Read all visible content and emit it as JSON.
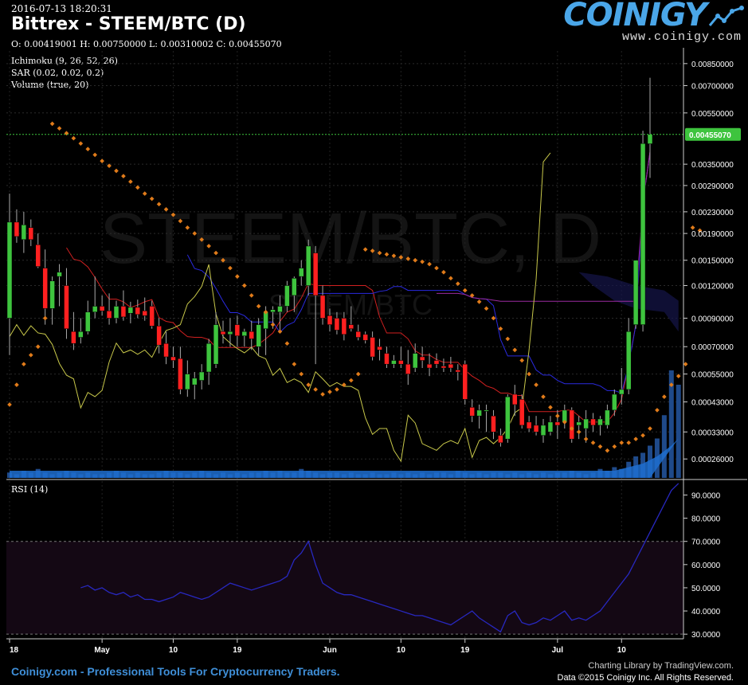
{
  "header": {
    "timestamp": "2016-07-13 18:20:31",
    "title": "Bittrex - STEEM/BTC (D)",
    "ohlc": "O: 0.00419001 H: 0.00750000 L: 0.00310002 C: 0.00455070",
    "indicators": [
      "Ichimoku (9, 26, 52, 26)",
      "SAR (0.02, 0.02, 0.2)",
      "Volume (true, 20)"
    ],
    "rsi_label": "RSI (14)"
  },
  "watermark": {
    "main": "STEEM/BTC, D",
    "sub": "STEEM/BTC"
  },
  "logo": {
    "name": "COINIGY",
    "url": "www.coinigy.com"
  },
  "footer": {
    "left": "Coinigy.com - Professional Tools For Cryptocurrency Traders.",
    "right_line1": "Charting Library by TradingView.com.",
    "right_line2": "Data ©2015 Coinigy Inc. All Rights Reserved."
  },
  "colors": {
    "up": "#3ec43e",
    "down": "#ff2020",
    "sar": "#e07b1a",
    "tenkan": "#d02020",
    "kijun": "#2a2ae0",
    "chikou": "#c8c84a",
    "spanb": "#9a2aa0",
    "volume": "#1f4a8a",
    "rsi": "#2828c0",
    "last_price": "#3ec43e"
  },
  "chart_data": [
    {
      "type": "candlestick",
      "title": "Bittrex - STEEM/BTC (D)",
      "scale": "log",
      "ylim": [
        0.00022,
        0.0095
      ],
      "y_ticks": [
        "0.00850000",
        "0.00700000",
        "0.00550000",
        "0.00350000",
        "0.00290000",
        "0.00230000",
        "0.00190000",
        "0.00150000",
        "0.00120000",
        "0.00090000",
        "0.00070000",
        "0.00055000",
        "0.00043000",
        "0.00033000",
        "0.00026000"
      ],
      "x_ticks": [
        "18",
        "May",
        "10",
        "19",
        "Jun",
        "10",
        "19",
        "Jul",
        "10"
      ],
      "last_price": "0.00455070",
      "candles": [
        {
          "o": 0.0009,
          "h": 0.0027,
          "l": 0.00065,
          "c": 0.0021
        },
        {
          "o": 0.0021,
          "h": 0.00235,
          "l": 0.00175,
          "c": 0.00185
        },
        {
          "o": 0.0018,
          "h": 0.0023,
          "l": 0.0016,
          "c": 0.00205
        },
        {
          "o": 0.002,
          "h": 0.00215,
          "l": 0.0017,
          "c": 0.0018
        },
        {
          "o": 0.00172,
          "h": 0.0019,
          "l": 0.0014,
          "c": 0.00142
        },
        {
          "o": 0.0014,
          "h": 0.00165,
          "l": 0.00085,
          "c": 0.00098
        },
        {
          "o": 0.00098,
          "h": 0.0013,
          "l": 0.00085,
          "c": 0.00125
        },
        {
          "o": 0.0013,
          "h": 0.00145,
          "l": 0.001,
          "c": 0.00135
        },
        {
          "o": 0.0012,
          "h": 0.0014,
          "l": 0.00075,
          "c": 0.00082
        },
        {
          "o": 0.0008,
          "h": 0.00095,
          "l": 0.00068,
          "c": 0.00072
        },
        {
          "o": 0.00076,
          "h": 0.0009,
          "l": 0.00072,
          "c": 0.0008
        },
        {
          "o": 0.0008,
          "h": 0.00105,
          "l": 0.00078,
          "c": 0.00095
        },
        {
          "o": 0.00095,
          "h": 0.0013,
          "l": 0.0009,
          "c": 0.001
        },
        {
          "o": 0.001,
          "h": 0.0011,
          "l": 0.00092,
          "c": 0.00096
        },
        {
          "o": 0.00096,
          "h": 0.00112,
          "l": 0.00085,
          "c": 0.0009
        },
        {
          "o": 0.0009,
          "h": 0.00105,
          "l": 0.00086,
          "c": 0.001
        },
        {
          "o": 0.001,
          "h": 0.00115,
          "l": 0.00088,
          "c": 0.00091
        },
        {
          "o": 0.00094,
          "h": 0.00104,
          "l": 0.00086,
          "c": 0.00099
        },
        {
          "o": 0.00099,
          "h": 0.00106,
          "l": 0.0009,
          "c": 0.00093
        },
        {
          "o": 0.00096,
          "h": 0.00108,
          "l": 0.00088,
          "c": 0.00092
        },
        {
          "o": 0.001,
          "h": 0.00105,
          "l": 0.00082,
          "c": 0.00084
        },
        {
          "o": 0.00084,
          "h": 0.0009,
          "l": 0.00066,
          "c": 0.00071
        },
        {
          "o": 0.00072,
          "h": 0.0008,
          "l": 0.0006,
          "c": 0.00064
        },
        {
          "o": 0.00064,
          "h": 0.0007,
          "l": 0.00058,
          "c": 0.00062
        },
        {
          "o": 0.00063,
          "h": 0.0007,
          "l": 0.00046,
          "c": 0.00048
        },
        {
          "o": 0.00048,
          "h": 0.00062,
          "l": 0.00045,
          "c": 0.00055
        },
        {
          "o": 0.0005,
          "h": 0.00056,
          "l": 0.00044,
          "c": 0.00053
        },
        {
          "o": 0.00052,
          "h": 0.0006,
          "l": 0.00048,
          "c": 0.00056
        },
        {
          "o": 0.00056,
          "h": 0.00075,
          "l": 0.0005,
          "c": 0.00072
        },
        {
          "o": 0.0006,
          "h": 0.00095,
          "l": 0.00058,
          "c": 0.00085
        },
        {
          "o": 0.0008,
          "h": 0.00088,
          "l": 0.00072,
          "c": 0.00078
        },
        {
          "o": 0.00078,
          "h": 0.0009,
          "l": 0.0007,
          "c": 0.0008
        },
        {
          "o": 0.00085,
          "h": 0.00092,
          "l": 0.0007,
          "c": 0.00077
        },
        {
          "o": 0.00077,
          "h": 0.00082,
          "l": 0.0007,
          "c": 0.0008
        },
        {
          "o": 0.0008,
          "h": 0.00088,
          "l": 0.00068,
          "c": 0.00075
        },
        {
          "o": 0.0007,
          "h": 0.0009,
          "l": 0.00065,
          "c": 0.00085
        },
        {
          "o": 0.00082,
          "h": 0.001,
          "l": 0.00065,
          "c": 0.00095
        },
        {
          "o": 0.00095,
          "h": 0.001,
          "l": 0.00082,
          "c": 0.00097
        },
        {
          "o": 0.00095,
          "h": 0.0011,
          "l": 0.0008,
          "c": 0.001
        },
        {
          "o": 0.001,
          "h": 0.00125,
          "l": 0.00095,
          "c": 0.0012
        },
        {
          "o": 0.0011,
          "h": 0.0013,
          "l": 0.00095,
          "c": 0.00128
        },
        {
          "o": 0.0013,
          "h": 0.0015,
          "l": 0.0012,
          "c": 0.0014
        },
        {
          "o": 0.0012,
          "h": 0.0018,
          "l": 0.0011,
          "c": 0.0017
        },
        {
          "o": 0.0016,
          "h": 0.0017,
          "l": 0.0006,
          "c": 0.0011
        },
        {
          "o": 0.0011,
          "h": 0.0012,
          "l": 0.00085,
          "c": 0.0009
        },
        {
          "o": 0.00092,
          "h": 0.00098,
          "l": 0.0008,
          "c": 0.00085
        },
        {
          "o": 0.0009,
          "h": 0.00095,
          "l": 0.00078,
          "c": 0.00081
        },
        {
          "o": 0.0009,
          "h": 0.00095,
          "l": 0.00074,
          "c": 0.00078
        },
        {
          "o": 0.00085,
          "h": 0.001,
          "l": 0.0008,
          "c": 0.00082
        },
        {
          "o": 0.0008,
          "h": 0.00085,
          "l": 0.00074,
          "c": 0.00076
        },
        {
          "o": 0.00078,
          "h": 0.0008,
          "l": 0.00072,
          "c": 0.00074
        },
        {
          "o": 0.00076,
          "h": 0.0008,
          "l": 0.00062,
          "c": 0.00064
        },
        {
          "o": 0.0007,
          "h": 0.00075,
          "l": 0.00062,
          "c": 0.00068
        },
        {
          "o": 0.00066,
          "h": 0.0007,
          "l": 0.00058,
          "c": 0.0006
        },
        {
          "o": 0.0006,
          "h": 0.00065,
          "l": 0.00058,
          "c": 0.00062
        },
        {
          "o": 0.00062,
          "h": 0.0007,
          "l": 0.00058,
          "c": 0.0006
        },
        {
          "o": 0.0006,
          "h": 0.00068,
          "l": 0.0005,
          "c": 0.00055
        },
        {
          "o": 0.00058,
          "h": 0.00072,
          "l": 0.00056,
          "c": 0.00066
        },
        {
          "o": 0.00064,
          "h": 0.0007,
          "l": 0.00058,
          "c": 0.00062
        },
        {
          "o": 0.0006,
          "h": 0.00066,
          "l": 0.00054,
          "c": 0.00058
        },
        {
          "o": 0.00062,
          "h": 0.00066,
          "l": 0.00058,
          "c": 0.0006
        },
        {
          "o": 0.00059,
          "h": 0.00063,
          "l": 0.00056,
          "c": 0.00058
        },
        {
          "o": 0.0006,
          "h": 0.00064,
          "l": 0.00056,
          "c": 0.00058
        },
        {
          "o": 0.00057,
          "h": 0.0006,
          "l": 0.00052,
          "c": 0.00056
        },
        {
          "o": 0.0006,
          "h": 0.00062,
          "l": 0.00042,
          "c": 0.00044
        },
        {
          "o": 0.00041,
          "h": 0.00044,
          "l": 0.00036,
          "c": 0.00038
        },
        {
          "o": 0.00038,
          "h": 0.00042,
          "l": 0.00034,
          "c": 0.0004
        },
        {
          "o": 0.0004,
          "h": 0.00042,
          "l": 0.00033,
          "c": 0.0004
        },
        {
          "o": 0.00038,
          "h": 0.0004,
          "l": 0.00031,
          "c": 0.00033
        },
        {
          "o": 0.00032,
          "h": 0.00034,
          "l": 0.00029,
          "c": 0.0003
        },
        {
          "o": 0.00031,
          "h": 0.00046,
          "l": 0.0003,
          "c": 0.00045
        },
        {
          "o": 0.00046,
          "h": 0.0005,
          "l": 0.00038,
          "c": 0.00042
        },
        {
          "o": 0.00044,
          "h": 0.00046,
          "l": 0.00034,
          "c": 0.00035
        },
        {
          "o": 0.00036,
          "h": 0.00038,
          "l": 0.00033,
          "c": 0.00034
        },
        {
          "o": 0.00035,
          "h": 0.00038,
          "l": 0.00032,
          "c": 0.00033
        },
        {
          "o": 0.00032,
          "h": 0.00037,
          "l": 0.0003,
          "c": 0.00035
        },
        {
          "o": 0.00033,
          "h": 0.00038,
          "l": 0.00032,
          "c": 0.00036
        },
        {
          "o": 0.00036,
          "h": 0.0004,
          "l": 0.00031,
          "c": 0.00035
        },
        {
          "o": 0.00036,
          "h": 0.00042,
          "l": 0.00034,
          "c": 0.0004
        },
        {
          "o": 0.0004,
          "h": 0.00041,
          "l": 0.0003,
          "c": 0.00031
        },
        {
          "o": 0.00035,
          "h": 0.00038,
          "l": 0.00031,
          "c": 0.00036
        },
        {
          "o": 0.00034,
          "h": 0.0004,
          "l": 0.0003,
          "c": 0.00037
        },
        {
          "o": 0.00037,
          "h": 0.00039,
          "l": 0.00033,
          "c": 0.00035
        },
        {
          "o": 0.00035,
          "h": 0.00038,
          "l": 0.00032,
          "c": 0.00037
        },
        {
          "o": 0.00035,
          "h": 0.00042,
          "l": 0.00034,
          "c": 0.0004
        },
        {
          "o": 0.0004,
          "h": 0.00048,
          "l": 0.00038,
          "c": 0.00046
        },
        {
          "o": 0.00046,
          "h": 0.00058,
          "l": 0.00042,
          "c": 0.00048
        },
        {
          "o": 0.00048,
          "h": 0.0009,
          "l": 0.00046,
          "c": 0.0008
        },
        {
          "o": 0.00085,
          "h": 0.0014,
          "l": 0.00082,
          "c": 0.0015
        },
        {
          "o": 0.00085,
          "h": 0.0047,
          "l": 0.0008,
          "c": 0.0042
        },
        {
          "o": 0.00419,
          "h": 0.0075,
          "l": 0.0031,
          "c": 0.00455
        }
      ],
      "sar": [
        0.00042,
        0.0005,
        0.0006,
        0.00065,
        0.0007,
        0.0009,
        0.005,
        0.0048,
        0.0046,
        0.0044,
        0.0042,
        0.004,
        0.0038,
        0.0036,
        0.00345,
        0.0033,
        0.00315,
        0.003,
        0.00285,
        0.0027,
        0.00258,
        0.00246,
        0.00235,
        0.00224,
        0.00212,
        0.002,
        0.0019,
        0.0018,
        0.0017,
        0.0016,
        0.0015,
        0.0014,
        0.0013,
        0.0012,
        0.0011,
        0.001,
        0.00095,
        0.00085,
        0.0008,
        0.00072,
        0.0006,
        0.00055,
        0.0005,
        0.00048,
        0.00046,
        0.00047,
        0.00048,
        0.0005,
        0.00052,
        0.00055,
        0.00165,
        0.00163,
        0.0016,
        0.00158,
        0.00156,
        0.00154,
        0.00152,
        0.0015,
        0.00148,
        0.00145,
        0.0014,
        0.00135,
        0.00128,
        0.00122,
        0.00115,
        0.0011,
        0.00104,
        0.00098,
        0.0009,
        0.00082,
        0.00075,
        0.00068,
        0.00062,
        0.00055,
        0.0005,
        0.00045,
        0.00041,
        0.00038,
        0.00036,
        0.00034,
        0.00033,
        0.00031,
        0.0003,
        0.00029,
        0.00028,
        0.00029,
        0.0003,
        0.0003,
        0.00031,
        0.00032,
        0.00034,
        0.0004,
        0.00045,
        0.0005,
        0.00054,
        0.0006,
        0.002,
        0.00195
      ],
      "volume": [
        3,
        2,
        4,
        3,
        5,
        3,
        2,
        3,
        4,
        3,
        2,
        3,
        2,
        2,
        3,
        4,
        3,
        2,
        3,
        2,
        2,
        3,
        4,
        3,
        3,
        2,
        3,
        4,
        3,
        2,
        3,
        2,
        3,
        2,
        3,
        3,
        4,
        3,
        4,
        3,
        3,
        5,
        4,
        3,
        2,
        3,
        3,
        2,
        3,
        2,
        2,
        3,
        2,
        2,
        3,
        2,
        3,
        2,
        3,
        2,
        3,
        3,
        2,
        4,
        3,
        2,
        3,
        2,
        3,
        3,
        2,
        3,
        2,
        3,
        2,
        3,
        2,
        3,
        3,
        4,
        3,
        2,
        3,
        5,
        4,
        6,
        5,
        9,
        12,
        14,
        18,
        22,
        35,
        60,
        52
      ],
      "volume_ma": [
        4,
        4,
        4,
        4,
        4,
        4,
        4,
        4,
        4,
        4,
        4,
        4,
        4,
        4,
        4,
        4,
        4,
        4,
        4,
        4,
        4,
        4,
        4,
        4,
        4,
        4,
        4,
        4,
        4,
        4,
        4,
        4,
        4,
        4,
        4,
        4,
        4,
        4,
        4,
        4,
        4,
        4,
        4,
        4,
        4,
        4,
        4,
        4,
        4,
        4,
        4,
        4,
        4,
        4,
        4,
        4,
        4,
        4,
        4,
        4,
        4,
        4,
        4,
        4,
        4,
        4,
        4,
        4,
        4,
        4,
        4,
        4,
        4,
        4,
        4,
        4,
        4,
        4,
        4,
        4,
        4,
        4,
        4,
        4,
        4,
        4,
        5,
        6,
        7,
        8,
        10,
        12,
        15,
        18,
        22
      ]
    },
    {
      "type": "line",
      "title": "RSI (14)",
      "ylim": [
        28,
        96
      ],
      "y_ticks": [
        "90.0000",
        "80.0000",
        "70.0000",
        "60.0000",
        "50.0000",
        "40.0000",
        "30.0000"
      ],
      "bands": [
        30,
        70
      ],
      "values": [
        50,
        51,
        49,
        50,
        48,
        47,
        48,
        46,
        47,
        45,
        45,
        44,
        45,
        46,
        48,
        47,
        46,
        45,
        46,
        48,
        50,
        52,
        51,
        50,
        49,
        50,
        51,
        52,
        53,
        55,
        62,
        65,
        70,
        60,
        52,
        50,
        48,
        47,
        47,
        46,
        45,
        44,
        43,
        42,
        41,
        40,
        39,
        38,
        38,
        37,
        36,
        35,
        34,
        36,
        38,
        40,
        37,
        35,
        33,
        31,
        38,
        40,
        35,
        34,
        35,
        37,
        36,
        38,
        40,
        36,
        37,
        36,
        38,
        40,
        44,
        48,
        52,
        56,
        62,
        68,
        74,
        80,
        86,
        92,
        95
      ]
    }
  ]
}
